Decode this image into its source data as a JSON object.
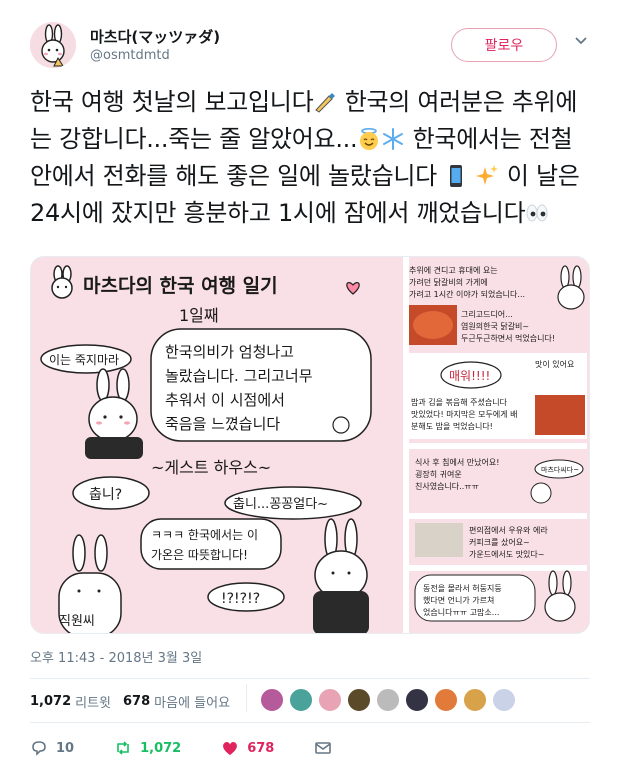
{
  "user": {
    "display_name": "마츠다(マッツァダ)",
    "handle": "@osmtdmtd",
    "follow_label": "팔로우"
  },
  "tweet": {
    "text_parts": [
      "한국 여행 첫날의 보고입니다",
      " 한국의 여러분은 추위에는 강합니다...죽는 줄 알았어요...",
      " 한국에서는 전철 안에서 전화를 해도 좋은 일에 놀랐습니다 ",
      " 이 날은 24시에 잤지만 흥분하고 1시에 잠에서 깨었습니다"
    ]
  },
  "media": {
    "left_panel": {
      "title": "마츠다의 한국 여행 일기",
      "day": "1일째",
      "speech_left": "이는 죽지마라",
      "main_text_1": "한국의비가 엄청나고",
      "main_text_2": "놀랐습니다. 그리고너무",
      "main_text_3": "추워서 이 시점에서",
      "main_text_4": "죽음을 느꼈습니다",
      "guesthouse": "~게스트 하우스~",
      "bubble_cold": "춥니?",
      "bubble_freezing": "춥니...꽁꽁얼다~",
      "bubble_warm_1": "ㅋㅋㅋ 한국에서는 이",
      "bubble_warm_2": "가온은 따뜻합니다!",
      "bubble_surprise": "!?!?!?",
      "staff_label": "직원씨"
    },
    "right_panel": {
      "note_1a": "추위에 견디고 휴대에 요는",
      "note_1b": "가려던 닭갈비의 가게에",
      "note_1c": "가려고 1시간 이야가 되었습니다...",
      "note_2a": "그리고드디어...",
      "note_2b": "염원의한국 닭갈비~",
      "note_2c": "두근두근하면서 먹었습니다!",
      "spicy": "매워!!!!",
      "note_3a": "맛이 있어요",
      "note_4a": "밥과 김을 볶음해 주셨습니다",
      "note_4b": "맛있었다! 마지막은 모두에게 배",
      "note_4c": "분해도 밥을 먹었습니다!",
      "note_5a": "식사 후 침에서 만났어요!",
      "note_5b": "굉장히 귀여운",
      "note_5c": "친사였습니다..ㅠㅠ",
      "bubble_greet": "마츠다씨다~",
      "note_6a": "편의점에서 우유와 에라",
      "note_6b": "커피크를 샀어요~",
      "note_6c": "가운드에서도 맛있다~",
      "note_7a": "동전을 몰라서 허둥지둥",
      "note_7b": "했다면 언니가 가르쳐",
      "note_7c": "었습니다ㅠㅠ 고맙소..."
    }
  },
  "timestamp": "오후 11:43 - 2018년 3월 3일",
  "stats": {
    "retweets_value": "1,072",
    "retweets_label": "리트윗",
    "likes_value": "678",
    "likes_label": "마음에 들어요"
  },
  "liker_colors": [
    "#b55a9a",
    "#4aa39a",
    "#e8a3b5",
    "#5a4a2a",
    "#bbbbbb",
    "#333344",
    "#e27a3a",
    "#d8a24a",
    "#c9d2e6"
  ],
  "actions": {
    "reply_count": "10",
    "retweet_count": "1,072",
    "like_count": "678"
  },
  "colors": {
    "accent": "#e0245e",
    "retweet_green": "#17bf63",
    "muted": "#657786"
  }
}
